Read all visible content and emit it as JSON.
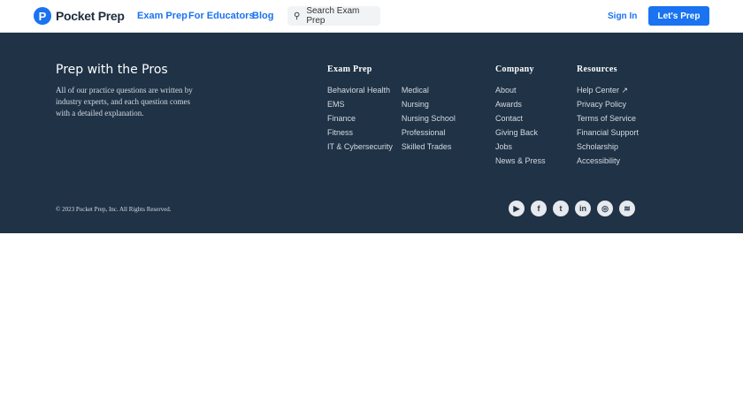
{
  "header": {
    "brand": "Pocket Prep",
    "nav": [
      "Exam Prep",
      "For Educators",
      "Blog"
    ],
    "search_placeholder": "Search Exam Prep",
    "sign_in": "Sign In",
    "cta": "Let's Prep"
  },
  "footer": {
    "title": "Prep with the Pros",
    "description": "All of our practice questions are written by industry experts, and each question comes with a detailed explanation.",
    "exam_prep": {
      "heading": "Exam Prep",
      "col1": [
        "Behavioral Health",
        "EMS",
        "Finance",
        "Fitness",
        "IT & Cybersecurity"
      ],
      "col2": [
        "Medical",
        "Nursing",
        "Nursing School",
        "Professional",
        "Skilled Trades"
      ]
    },
    "company": {
      "heading": "Company",
      "items": [
        "About",
        "Awards",
        "Contact",
        "Giving Back",
        "Jobs",
        "News & Press"
      ]
    },
    "resources": {
      "heading": "Resources",
      "items": [
        "Help Center ↗",
        "Privacy Policy",
        "Terms of Service",
        "Financial Support",
        "Scholarship",
        "Accessibility"
      ]
    },
    "copyright": "© 2023 Pocket Prep, Inc. All Rights Reserved.",
    "social": [
      {
        "name": "youtube",
        "glyph": "▶"
      },
      {
        "name": "facebook",
        "glyph": "f"
      },
      {
        "name": "twitter",
        "glyph": "t"
      },
      {
        "name": "linkedin",
        "glyph": "in"
      },
      {
        "name": "instagram",
        "glyph": "◎"
      },
      {
        "name": "spotify",
        "glyph": "≋"
      }
    ]
  }
}
